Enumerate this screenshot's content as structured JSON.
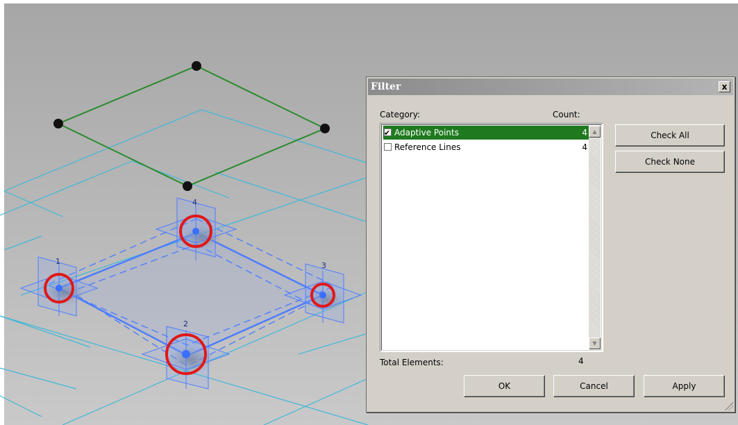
{
  "viewport": {
    "point_labels": [
      "1",
      "2",
      "3",
      "4"
    ],
    "colors": {
      "grid": "#3fb8d8",
      "reference_line": "#2a8a2a",
      "adaptive_point": "#3a6fff",
      "highlight": "#e01818"
    }
  },
  "filter_dialog": {
    "title": "Filter",
    "close_glyph": "x",
    "category_header": "Category:",
    "count_header": "Count:",
    "items": [
      {
        "label": "Adaptive Points",
        "count": "4",
        "checked": true,
        "selected": true
      },
      {
        "label": "Reference Lines",
        "count": "4",
        "checked": false,
        "selected": false
      }
    ],
    "check_all_label": "Check All",
    "check_none_label": "Check None",
    "total_label": "Total Elements:",
    "total_value": "4",
    "ok_label": "OK",
    "cancel_label": "Cancel",
    "apply_label": "Apply",
    "selection_color": "#1f7a1f"
  }
}
